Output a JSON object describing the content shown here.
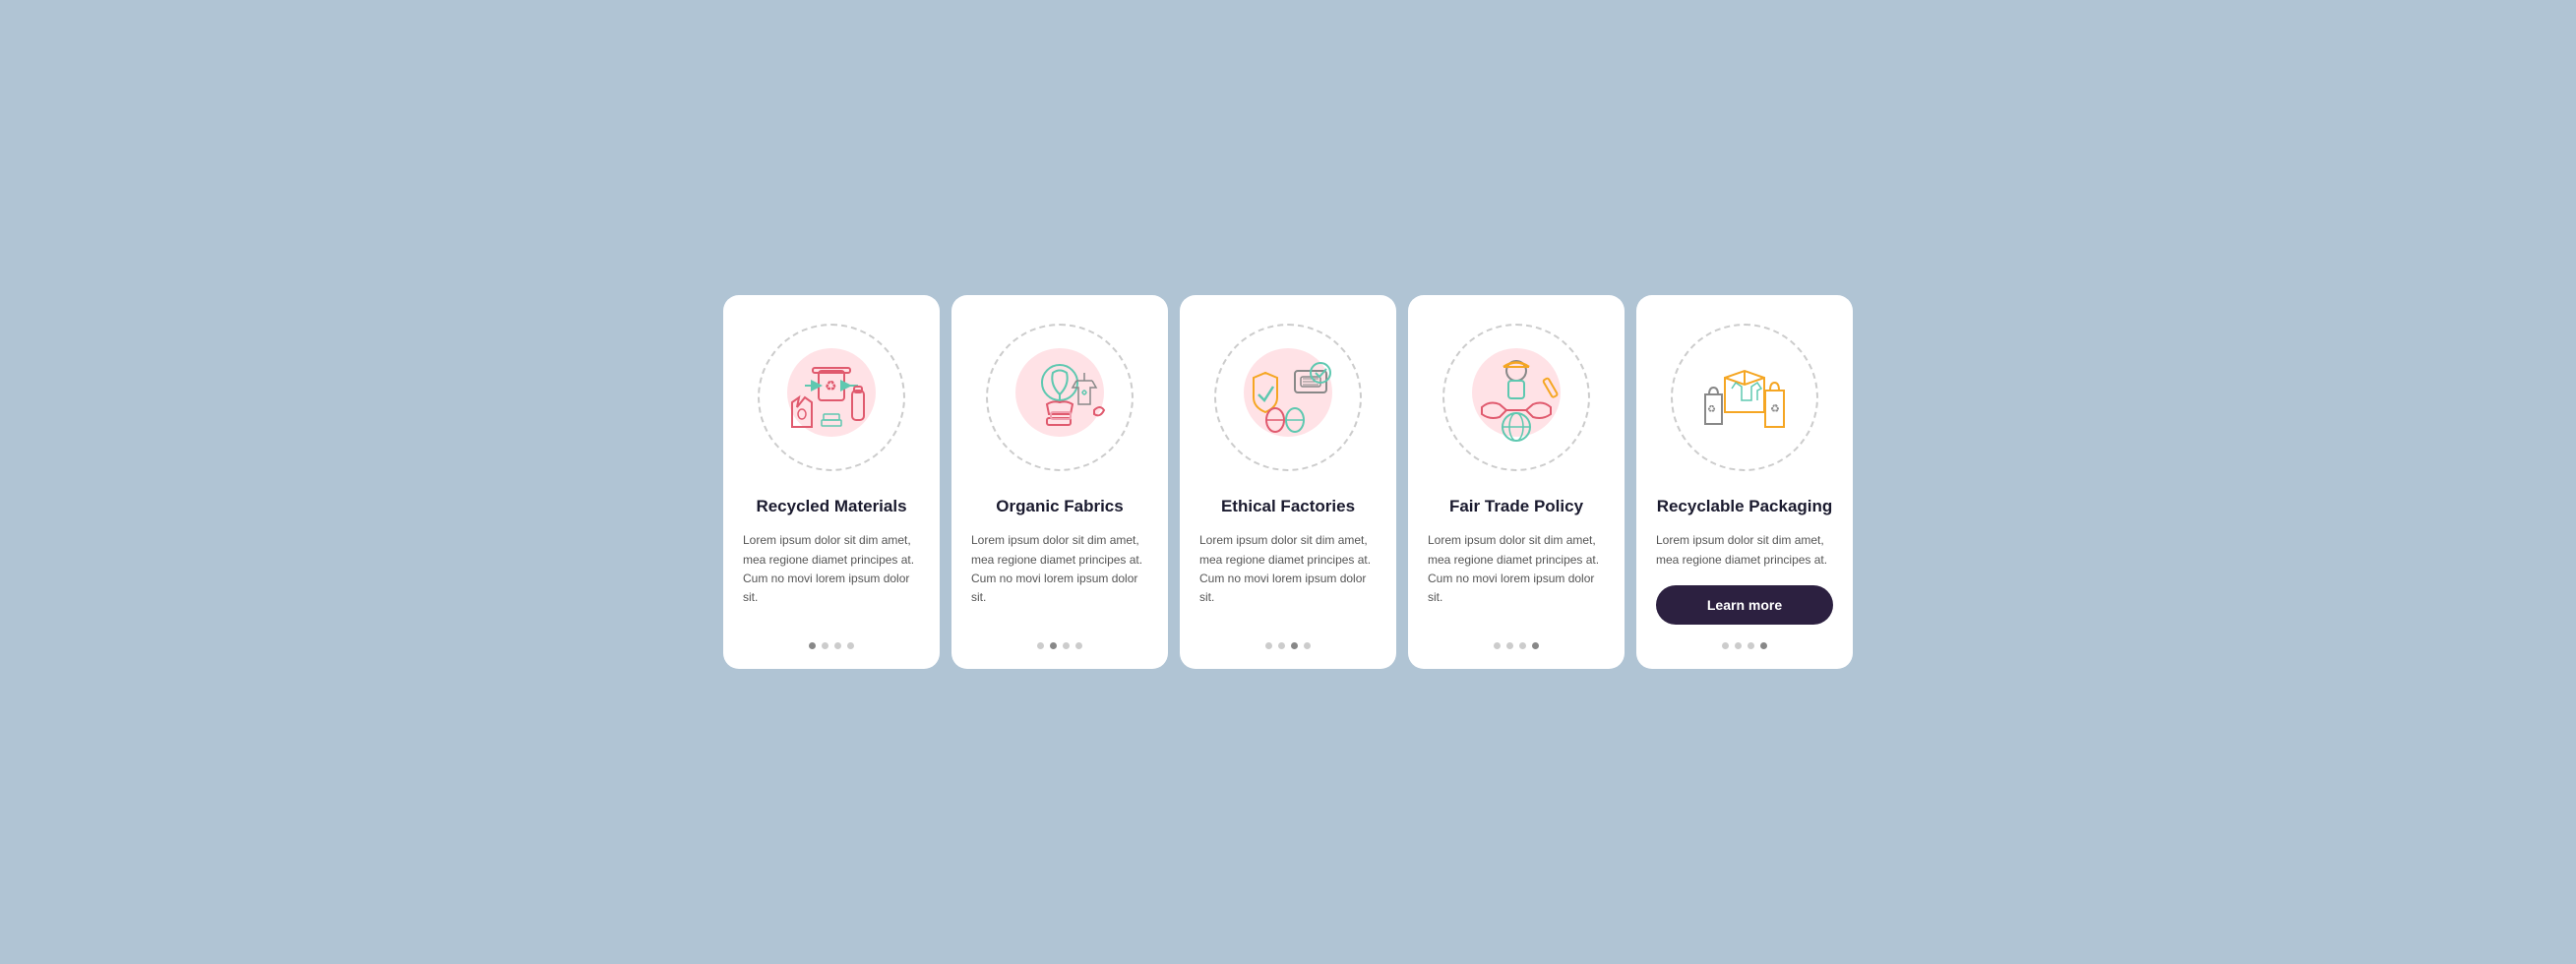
{
  "cards": [
    {
      "id": "recycled-materials",
      "title": "Recycled Materials",
      "body": "Lorem ipsum dolor sit dim amet, mea regione diamet principes at. Cum no movi lorem ipsum dolor sit.",
      "dots": [
        true,
        false,
        false,
        false
      ],
      "active_dot": 0,
      "show_button": false,
      "icon": "recycled"
    },
    {
      "id": "organic-fabrics",
      "title": "Organic Fabrics",
      "body": "Lorem ipsum dolor sit dim amet, mea regione diamet principes at. Cum no movi lorem ipsum dolor sit.",
      "dots": [
        false,
        true,
        false,
        false
      ],
      "active_dot": 1,
      "show_button": false,
      "icon": "organic"
    },
    {
      "id": "ethical-factories",
      "title": "Ethical Factories",
      "body": "Lorem ipsum dolor sit dim amet, mea regione diamet principes at. Cum no movi lorem ipsum dolor sit.",
      "dots": [
        false,
        false,
        true,
        false
      ],
      "active_dot": 2,
      "show_button": false,
      "icon": "ethical"
    },
    {
      "id": "fair-trade-policy",
      "title": "Fair Trade Policy",
      "body": "Lorem ipsum dolor sit dim amet, mea regione diamet principes at. Cum no movi lorem ipsum dolor sit.",
      "dots": [
        false,
        false,
        false,
        true
      ],
      "active_dot": 3,
      "show_button": false,
      "icon": "fairtrade"
    },
    {
      "id": "recyclable-packaging",
      "title": "Recyclable Packaging",
      "body": "Lorem ipsum dolor sit dim amet, mea regione diamet principes at.",
      "dots": [
        false,
        false,
        false,
        true
      ],
      "active_dot": 3,
      "show_button": true,
      "button_label": "Learn more",
      "icon": "packaging"
    }
  ]
}
